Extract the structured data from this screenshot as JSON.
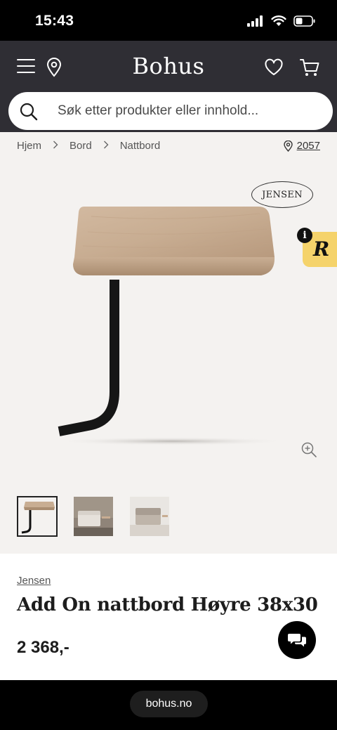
{
  "status_bar": {
    "time": "15:43"
  },
  "header": {
    "brand": "Bohus",
    "search_placeholder": "Søk etter produkter eller innhold..."
  },
  "breadcrumb": {
    "items": [
      "Hjem",
      "Bord",
      "Nattbord"
    ],
    "zip": "2057"
  },
  "product": {
    "image_logo": "JENSEN",
    "brand": "Jensen",
    "title": "Add On nattbord Høyre 38x30",
    "price": "2 368,-"
  },
  "browser": {
    "url": "bohus.no"
  },
  "colors": {
    "header_bg": "#2f2e34",
    "page_bg": "#f4f2f0",
    "badge_yellow": "#f5d36b"
  },
  "icons": [
    "menu-icon",
    "location-pin-icon",
    "heart-icon",
    "cart-icon",
    "search-icon",
    "zoom-in-icon",
    "chat-icon",
    "signal-icon",
    "wifi-icon",
    "battery-icon"
  ]
}
